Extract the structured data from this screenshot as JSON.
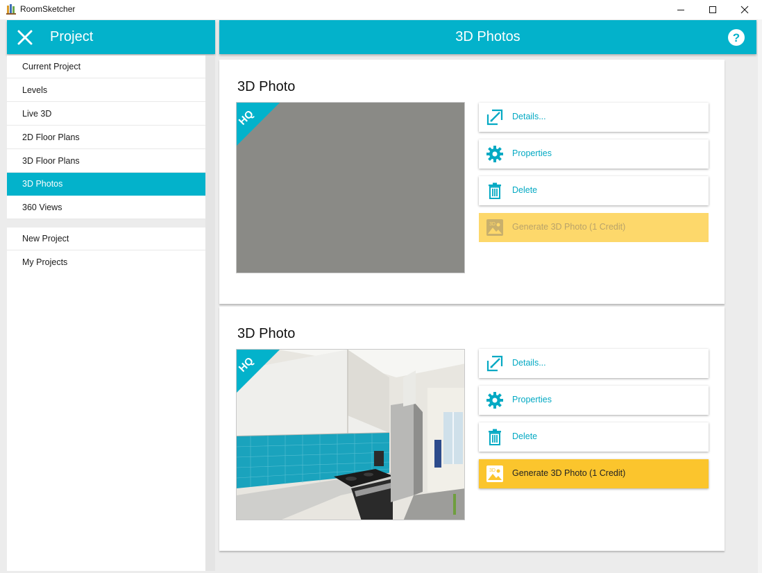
{
  "window": {
    "title": "RoomSketcher",
    "minimize_icon": "minimize-icon",
    "maximize_icon": "maximize-icon",
    "close_icon": "close-icon"
  },
  "sidebar": {
    "title": "Project",
    "close_icon": "close-x-icon",
    "items": [
      {
        "label": "Current Project",
        "active": false
      },
      {
        "label": "Levels",
        "active": false
      },
      {
        "label": "Live 3D",
        "active": false
      },
      {
        "label": "2D Floor Plans",
        "active": false
      },
      {
        "label": "3D Floor Plans",
        "active": false
      },
      {
        "label": "3D Photos",
        "active": true
      },
      {
        "label": "360 Views",
        "active": false
      }
    ],
    "secondary_items": [
      {
        "label": "New Project"
      },
      {
        "label": "My Projects"
      }
    ]
  },
  "header": {
    "title": "3D Photos",
    "help_icon": "help-icon"
  },
  "cards": [
    {
      "title": "3D Photo",
      "badge": "HQ",
      "photo_state": "placeholder",
      "actions": {
        "details": "Details...",
        "properties": "Properties",
        "delete": "Delete",
        "generate": "Generate 3D Photo (1 Credit)"
      },
      "generate_enabled": false
    },
    {
      "title": "3D Photo",
      "badge": "HQ",
      "photo_state": "rendered-kitchen",
      "actions": {
        "details": "Details...",
        "properties": "Properties",
        "delete": "Delete",
        "generate": "Generate 3D Photo (1 Credit)"
      },
      "generate_enabled": true
    }
  ],
  "colors": {
    "accent": "#03b2cb",
    "generate_enabled": "#fbc52d",
    "generate_disabled": "#fdd86b"
  }
}
